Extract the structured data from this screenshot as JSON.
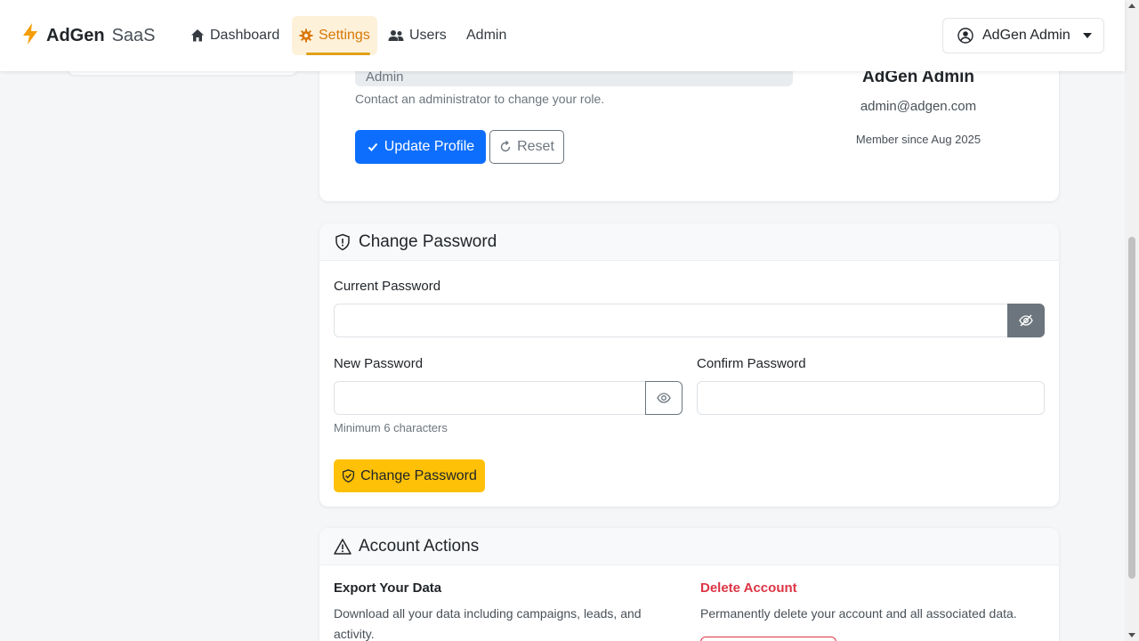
{
  "navbar": {
    "brand_bold": "AdGen",
    "brand_light": "SaaS",
    "items": [
      {
        "label": "Dashboard",
        "icon": "home-icon"
      },
      {
        "label": "Settings",
        "icon": "gear-icon",
        "active": true
      },
      {
        "label": "Users",
        "icon": "users-icon"
      },
      {
        "label": "Admin"
      }
    ],
    "user_name": "AdGen Admin"
  },
  "profile": {
    "role_value": "Admin",
    "role_help": "Contact an administrator to change your role.",
    "update_label": "Update Profile",
    "reset_label": "Reset",
    "summary_name": "AdGen Admin",
    "summary_email": "admin@adgen.com",
    "member_since": "Member since Aug 2025"
  },
  "password": {
    "title": "Change Password",
    "current_label": "Current Password",
    "current_value": "",
    "new_label": "New Password",
    "new_value": "",
    "new_help": "Minimum 6 characters",
    "confirm_label": "Confirm Password",
    "confirm_value": "",
    "submit_label": "Change Password"
  },
  "actions": {
    "title": "Account Actions",
    "export_title": "Export Your Data",
    "export_desc": "Download all your data including campaigns, leads, and activity.",
    "delete_title": "Delete Account",
    "delete_desc": "Permanently delete your account and all associated data."
  },
  "colors": {
    "primary": "#0d6efd",
    "warning": "#ffc107",
    "danger": "#dc3545",
    "accent": "#d97706"
  }
}
